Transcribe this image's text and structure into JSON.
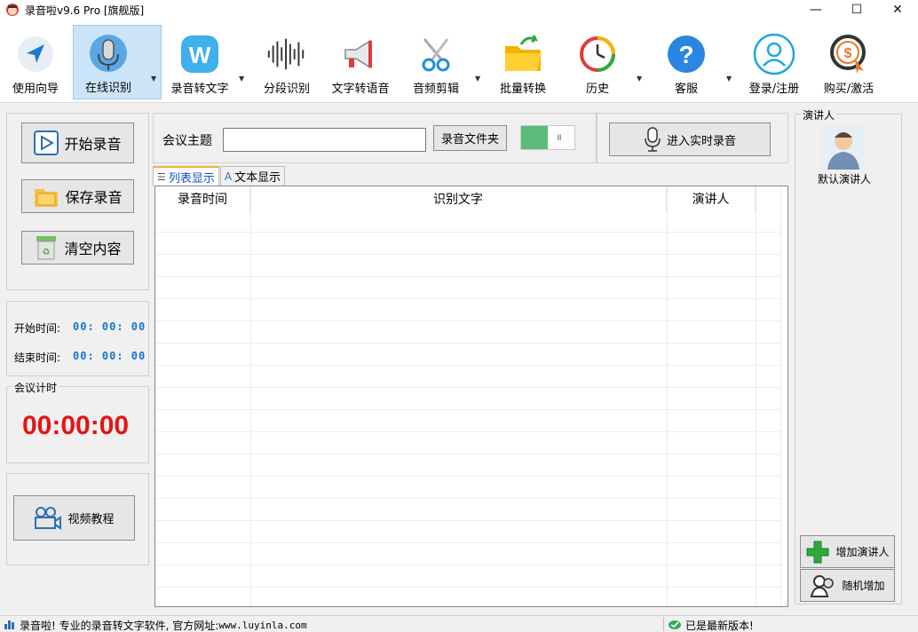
{
  "window": {
    "title": "录音啦v9.6 Pro [旗舰版]",
    "minimize": "—",
    "maximize": "☐",
    "close": "✕"
  },
  "toolbar": {
    "items": [
      {
        "label": "使用向导",
        "icon": "navigation-arrow-icon"
      },
      {
        "label": "在线识别",
        "icon": "microphone-icon"
      },
      {
        "label": "录音转文字",
        "icon": "w-letter-icon"
      },
      {
        "label": "分段识别",
        "icon": "waveform-icon"
      },
      {
        "label": "文字转语音",
        "icon": "megaphone-icon"
      },
      {
        "label": "音频剪辑",
        "icon": "scissors-icon"
      },
      {
        "label": "批量转换",
        "icon": "folder-export-icon"
      },
      {
        "label": "历史",
        "icon": "history-clock-icon"
      },
      {
        "label": "客服",
        "icon": "help-question-icon"
      },
      {
        "label": "登录/注册",
        "icon": "user-icon"
      },
      {
        "label": "购买/激活",
        "icon": "purchase-coin-icon"
      }
    ]
  },
  "left": {
    "start_record": "开始录音",
    "save_record": "保存录音",
    "clear_content": "清空内容",
    "start_time_label": "开始时间:",
    "start_time_value": "00: 00: 00",
    "end_time_label": "结束时间:",
    "end_time_value": "00: 00: 00",
    "timer_group": "会议计时",
    "timer_value": "00:00:00",
    "video_tutorial": "视频教程"
  },
  "top": {
    "meeting_topic_label": "会议主题",
    "meeting_topic_value": "",
    "record_folder": "录音文件夹",
    "toggle_on": true,
    "realtime_record": "进入实时录音"
  },
  "tabs": [
    {
      "label": "列表显示",
      "active": true
    },
    {
      "label": "文本显示",
      "active": false
    }
  ],
  "table": {
    "columns": [
      "录音时间",
      "识别文字",
      "演讲人"
    ],
    "rows": []
  },
  "speakers": {
    "group_title": "演讲人",
    "items": [
      {
        "name": "默认演讲人"
      }
    ],
    "add_speaker": "增加演讲人",
    "random_add": "随机增加"
  },
  "status": {
    "left_prefix": "录音啦! 专业的录音转文字软件, 官方网址: ",
    "url": "www.luyinla.com",
    "right": "已是最新版本!"
  },
  "colors": {
    "accent_blue": "#1773d1",
    "timer_red": "#e51414",
    "toggle_green": "#5dbb7a",
    "active_tab_bg": "#cce4f7"
  }
}
